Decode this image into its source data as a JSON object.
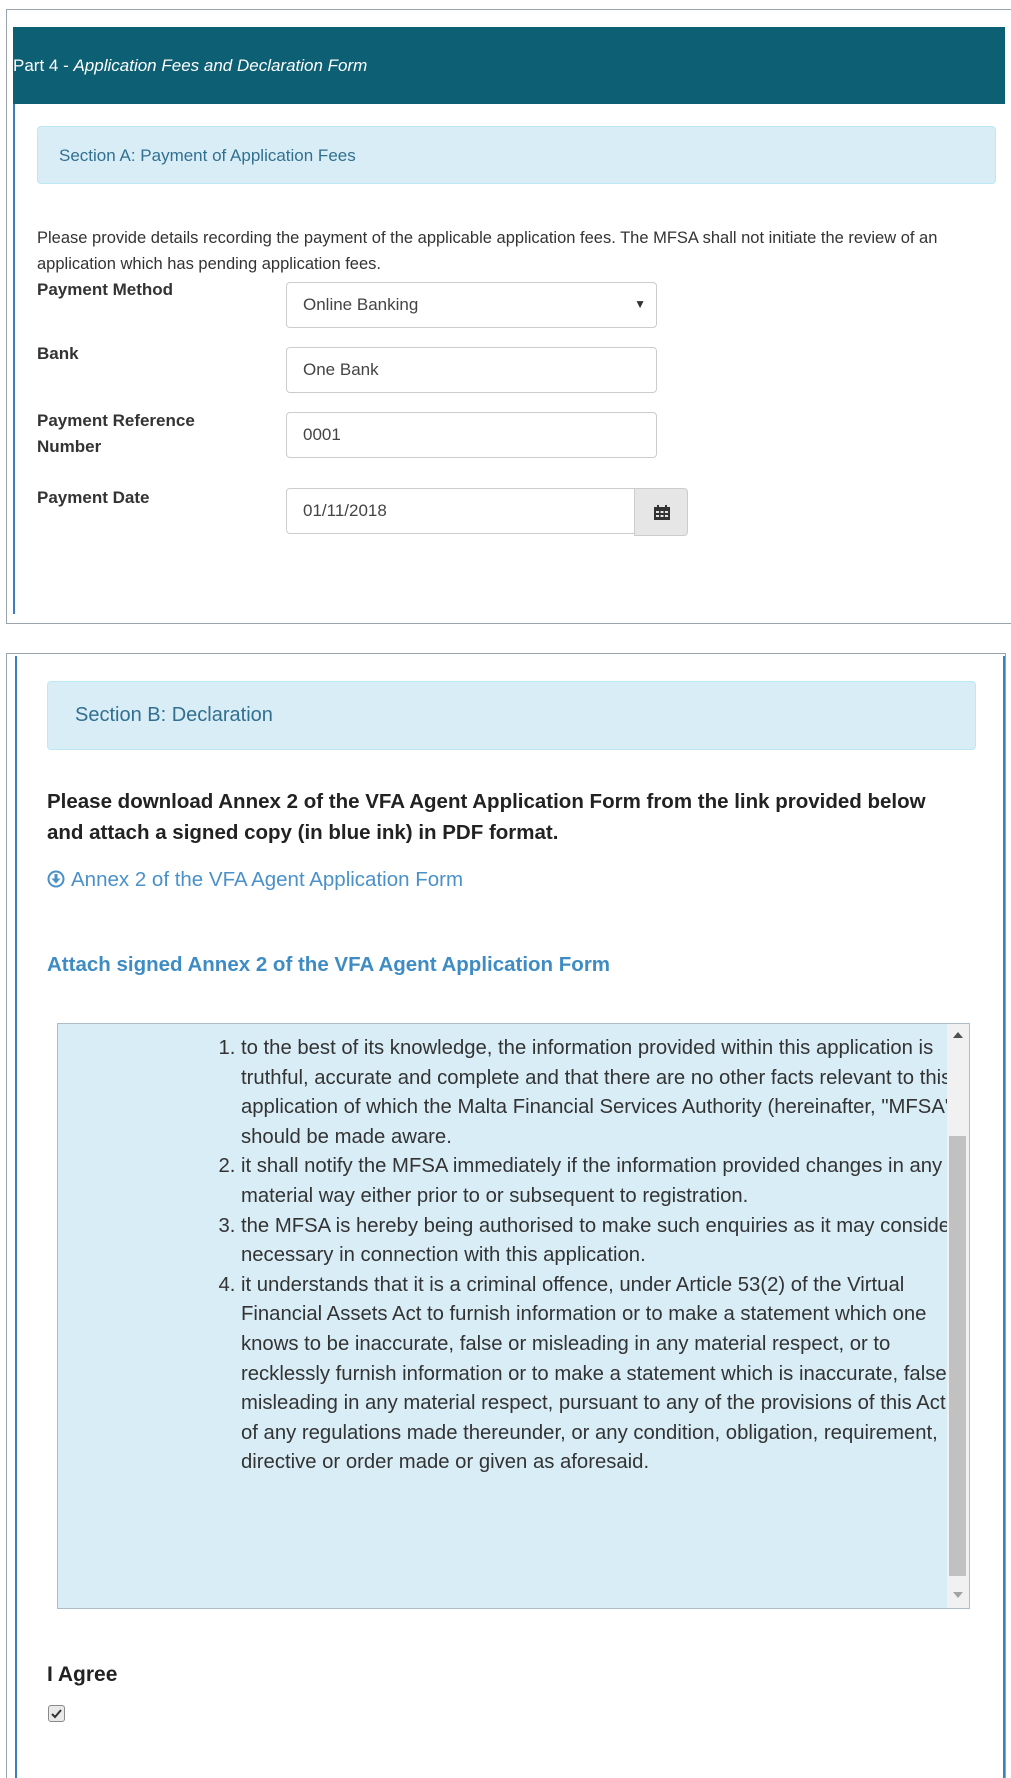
{
  "part4": {
    "prefix": "Part 4 - ",
    "title": "Application Fees and Declaration Form"
  },
  "section_a": {
    "title": "Section A: Payment of Application Fees",
    "intro": "Please provide details recording the payment of the applicable application fees. The MFSA shall not initiate the review of an application which has pending application fees.",
    "payment_method": {
      "label": "Payment Method",
      "value": "Online Banking"
    },
    "bank": {
      "label": "Bank",
      "value": "One Bank"
    },
    "payment_reference": {
      "label": "Payment Reference Number",
      "value": "0001"
    },
    "payment_date": {
      "label": "Payment Date",
      "value": "01/11/2018",
      "icon": "calendar-icon"
    }
  },
  "section_b": {
    "title": "Section B: Declaration",
    "instruction": "Please download Annex 2 of the VFA Agent Application Form from the link provided below and attach a signed copy (in blue ink) in PDF format.",
    "download_link": "Annex 2 of the VFA Agent Application Form",
    "download_icon": "download-circle-icon",
    "attach_label": "Attach signed Annex 2 of the VFA Agent Application Form",
    "declarations": [
      "to the best of its knowledge, the information provided within this application is truthful, accurate and complete and that there are no other facts relevant to this application of which the Malta Financial Services Authority (hereinafter, \"MFSA\") should be made aware.",
      "it shall notify the MFSA immediately if the information provided changes in any material way either prior to or subsequent to registration.",
      "the MFSA is hereby being authorised to make such enquiries as it may consider necessary in connection with this application.",
      "it understands that it is a criminal offence, under Article 53(2) of the Virtual Financial Assets Act to furnish information or to make a statement which one knows to be inaccurate, false or misleading in any material respect, or to recklessly furnish information or to make a statement which is inaccurate, false or misleading in any material respect, pursuant to any of the provisions of this Act or of any regulations made thereunder, or any condition, obligation, requirement, directive or order made or given as aforesaid."
    ],
    "agree_label": "I Agree",
    "agree_checked": true
  },
  "colors": {
    "header_bg": "#0d5f73",
    "info_bg": "#d9edf7",
    "info_text": "#31708f",
    "link": "#4a90c9"
  }
}
